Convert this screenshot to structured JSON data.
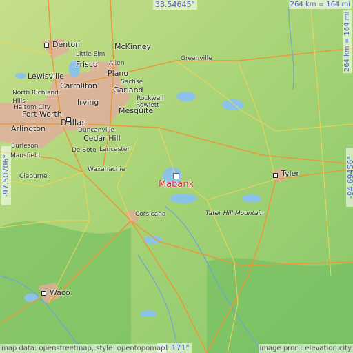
{
  "coordinates": {
    "north": "33.54645°",
    "south": "31.171°",
    "west": "-97.50706°",
    "east": "-94.69456°"
  },
  "scale": {
    "top": "264 km = 164 mi",
    "right": "264 km = 164 mi"
  },
  "highlight": "Mabank",
  "feature_label": "Tater Hill Mountain",
  "cities": [
    "Denton",
    "McKinney",
    "Little Elm",
    "Frisco",
    "Allen",
    "Greenville",
    "Lewisville",
    "Plano",
    "Sachse",
    "Carrollton",
    "Garland",
    "Rockwall",
    "North Richland Hills",
    "Irving",
    "Rowlett",
    "Haltom City",
    "Mesquite",
    "Fort Worth",
    "Dallas",
    "Arlington",
    "Duncanville",
    "Cedar Hill",
    "Burleson",
    "De Soto",
    "Lancaster",
    "Mansfield",
    "Waxahachie",
    "Cleburne",
    "Corsicana",
    "Tyler",
    "Waco"
  ],
  "attribution": {
    "left": "map data: openstreetmap, style: opentopomap",
    "right": "image proc.: elevation.city"
  },
  "colors": {
    "terrain_low": "#7fc85f",
    "terrain_high": "#c8e08f",
    "water": "#8cc2e8",
    "urban": "#e8a7a0",
    "highlight": "#e0303a"
  }
}
